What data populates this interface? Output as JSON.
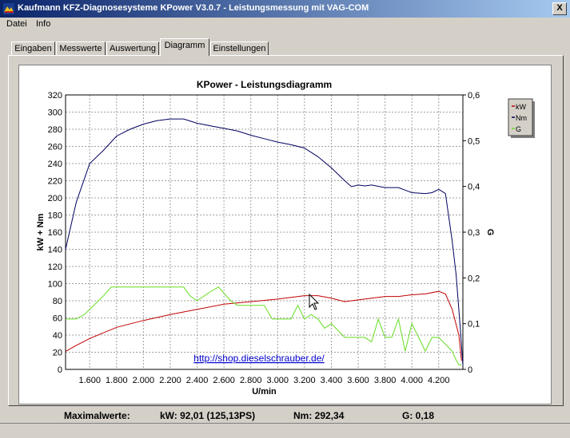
{
  "window": {
    "title": "Kaufmann KFZ-Diagnosesysteme  KPower V3.0.7 - Leistungsmessung mit VAG-COM",
    "close_label": "X"
  },
  "menu": {
    "items": [
      "Datei",
      "Info"
    ]
  },
  "tabs": [
    "Eingaben",
    "Messwerte",
    "Auswertung",
    "Diagramm",
    "Einstellungen"
  ],
  "active_tab": "Diagramm",
  "chart_data": {
    "type": "line",
    "title": "KPower - Leistungsdiagramm",
    "xlabel": "U/min",
    "ylabel_left": "kW + Nm",
    "ylabel_right": "G",
    "xlim": [
      1420,
      4380
    ],
    "ylim_left": [
      0,
      320
    ],
    "ylim_right": [
      0,
      0.6
    ],
    "x_ticks": [
      "1.600",
      "1.800",
      "2.000",
      "2.200",
      "2.400",
      "2.600",
      "2.800",
      "3.000",
      "3.200",
      "3.400",
      "3.600",
      "3.800",
      "4.000",
      "4.200"
    ],
    "x_tick_values": [
      1600,
      1800,
      2000,
      2200,
      2400,
      2600,
      2800,
      3000,
      3200,
      3400,
      3600,
      3800,
      4000,
      4200
    ],
    "y_left_ticks": [
      0,
      20,
      40,
      60,
      80,
      100,
      120,
      140,
      160,
      180,
      200,
      220,
      240,
      260,
      280,
      300,
      320
    ],
    "y_right_ticks": [
      "0",
      "0,1",
      "0,2",
      "0,3",
      "0,4",
      "0,5",
      "0,6"
    ],
    "y_right_values": [
      0,
      0.1,
      0.2,
      0.3,
      0.4,
      0.5,
      0.6
    ],
    "grid": true,
    "legend_position": "right",
    "annotation": "http://shop.dieselschrauber.de/",
    "series": [
      {
        "name": "kW",
        "axis": "left",
        "color": "#c00000",
        "x": [
          1420,
          1500,
          1600,
          1800,
          2000,
          2200,
          2400,
          2600,
          2800,
          3000,
          3200,
          3300,
          3400,
          3500,
          3600,
          3700,
          3800,
          3900,
          4000,
          4100,
          4200,
          4250,
          4300,
          4350,
          4370
        ],
        "y": [
          21,
          28,
          36,
          49,
          57,
          64,
          70,
          76,
          79,
          82,
          86,
          86,
          83,
          79,
          81,
          83,
          85,
          85,
          87,
          88,
          91,
          88,
          70,
          40,
          10
        ]
      },
      {
        "name": "Nm",
        "axis": "left",
        "color": "#000060",
        "x": [
          1420,
          1500,
          1600,
          1700,
          1800,
          1900,
          2000,
          2100,
          2200,
          2300,
          2400,
          2500,
          2600,
          2700,
          2800,
          2900,
          3000,
          3100,
          3200,
          3300,
          3400,
          3500,
          3550,
          3600,
          3650,
          3700,
          3800,
          3900,
          4000,
          4100,
          4150,
          4200,
          4250,
          4300,
          4330,
          4360,
          4380
        ],
        "y": [
          140,
          195,
          240,
          255,
          272,
          280,
          286,
          290,
          292,
          292,
          287,
          284,
          281,
          278,
          273,
          269,
          265,
          262,
          258,
          248,
          235,
          220,
          213,
          215,
          214,
          215,
          212,
          212,
          206,
          205,
          206,
          210,
          205,
          150,
          110,
          50,
          5
        ]
      },
      {
        "name": "G",
        "axis": "right",
        "color": "#66dd22",
        "x": [
          1420,
          1480,
          1500,
          1560,
          1700,
          1760,
          1800,
          2000,
          2200,
          2250,
          2300,
          2350,
          2400,
          2500,
          2560,
          2650,
          2700,
          2800,
          2900,
          2960,
          3000,
          3100,
          3150,
          3200,
          3250,
          3300,
          3350,
          3400,
          3500,
          3550,
          3600,
          3650,
          3700,
          3750,
          3800,
          3850,
          3900,
          3950,
          4000,
          4050,
          4100,
          4150,
          4200,
          4300,
          4330,
          4350,
          4370
        ],
        "y": [
          0.11,
          0.11,
          0.11,
          0.12,
          0.16,
          0.18,
          0.18,
          0.18,
          0.18,
          0.18,
          0.18,
          0.16,
          0.15,
          0.17,
          0.18,
          0.15,
          0.14,
          0.14,
          0.14,
          0.11,
          0.11,
          0.11,
          0.14,
          0.11,
          0.12,
          0.11,
          0.09,
          0.1,
          0.07,
          0.07,
          0.07,
          0.07,
          0.06,
          0.11,
          0.07,
          0.07,
          0.11,
          0.04,
          0.1,
          0.07,
          0.04,
          0.07,
          0.07,
          0.04,
          0.02,
          0.01,
          0.01
        ]
      }
    ]
  },
  "footer": {
    "max_label": "Maximalwerte:",
    "kw_label": "kW: 92,01 (125,13PS)",
    "nm_label": "Nm: 292,34",
    "g_label": "G: 0,18"
  }
}
